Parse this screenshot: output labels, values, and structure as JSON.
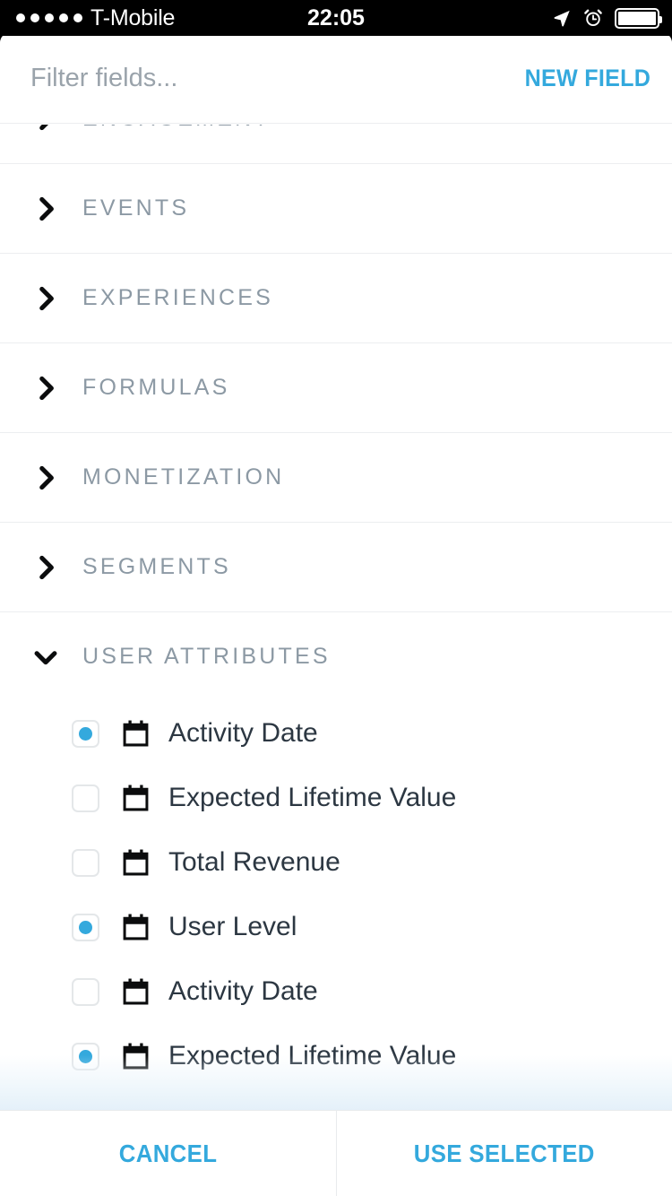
{
  "status_bar": {
    "carrier": "T-Mobile",
    "signal_dots": 5,
    "time": "22:05",
    "icons": [
      "location-arrow-icon",
      "alarm-clock-icon",
      "battery-icon"
    ],
    "battery_level": 100
  },
  "header": {
    "filter_placeholder": "Filter fields...",
    "filter_value": "",
    "new_field_label": "NEW FIELD"
  },
  "sections": [
    {
      "label": "ENGAGEMENT",
      "expanded": false,
      "icon": "chevron-right-icon"
    },
    {
      "label": "EVENTS",
      "expanded": false,
      "icon": "chevron-right-icon"
    },
    {
      "label": "EXPERIENCES",
      "expanded": false,
      "icon": "chevron-right-icon"
    },
    {
      "label": "FORMULAS",
      "expanded": false,
      "icon": "chevron-right-icon"
    },
    {
      "label": "MONETIZATION",
      "expanded": false,
      "icon": "chevron-right-icon"
    },
    {
      "label": "SEGMENTS",
      "expanded": false,
      "icon": "chevron-right-icon"
    },
    {
      "label": "USER ATTRIBUTES",
      "expanded": true,
      "icon": "chevron-down-icon"
    }
  ],
  "fields": [
    {
      "label": "Activity Date",
      "checked": true,
      "icon": "calendar-icon"
    },
    {
      "label": "Expected Lifetime Value",
      "checked": false,
      "icon": "calendar-icon"
    },
    {
      "label": "Total Revenue",
      "checked": false,
      "icon": "calendar-icon"
    },
    {
      "label": "User Level",
      "checked": true,
      "icon": "calendar-icon"
    },
    {
      "label": "Activity Date",
      "checked": false,
      "icon": "calendar-icon"
    },
    {
      "label": "Expected Lifetime Value",
      "checked": true,
      "icon": "calendar-icon"
    }
  ],
  "footer": {
    "cancel_label": "CANCEL",
    "use_selected_label": "USE SELECTED"
  },
  "colors": {
    "accent": "#34a9dd",
    "section_label": "#8c99a4",
    "field_label": "#2c3742",
    "divider": "#eceef0",
    "placeholder": "#9aa3ab",
    "status_bar_bg": "#000000",
    "sheet_bg": "#ffffff"
  }
}
